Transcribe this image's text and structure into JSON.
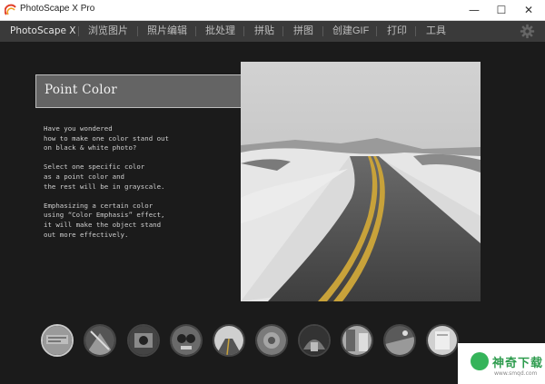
{
  "window": {
    "title": "PhotoScape X Pro",
    "minimize": "—",
    "maximize": "☐",
    "close": "✕"
  },
  "menu": {
    "items": [
      {
        "label": "PhotoScape X"
      },
      {
        "label": "浏览图片"
      },
      {
        "label": "照片编辑"
      },
      {
        "label": "批处理"
      },
      {
        "label": "拼贴"
      },
      {
        "label": "拼图"
      },
      {
        "label": "创建GIF"
      },
      {
        "label": "打印"
      },
      {
        "label": "工具"
      }
    ]
  },
  "feature": {
    "title": "Point Color",
    "paragraphs": [
      "Have you wondered\nhow to make one color stand out\non black & white photo?",
      "Select one specific color\nas a point color and\nthe rest will be in grayscale.",
      "Emphasizing a certain color\nusing “Color Emphasis” effect,\nit will make the object stand\nout more effectively."
    ]
  },
  "watermark": {
    "text": "神奇下载",
    "sub": "www.smqd.com"
  },
  "colors": {
    "menubar": "#3a3a3a",
    "background": "#1b1b1b",
    "watermark_green": "#35b45a"
  }
}
